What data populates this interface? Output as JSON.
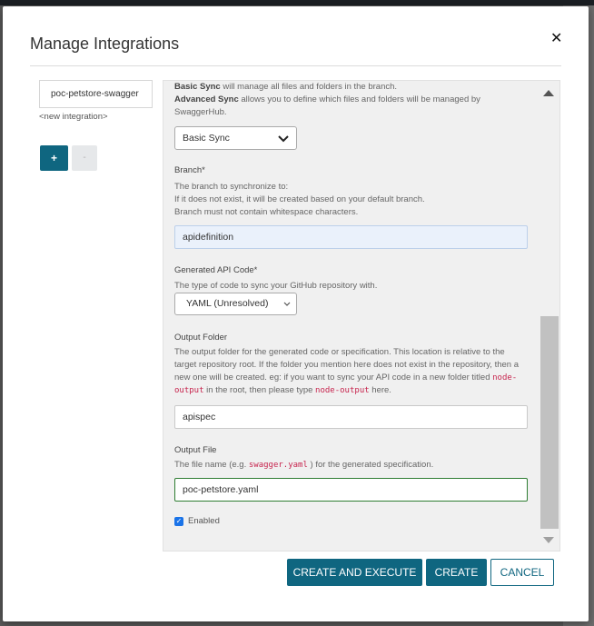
{
  "modal": {
    "title": "Manage Integrations",
    "close_icon": "close-icon"
  },
  "sidebar": {
    "integrations": [
      {
        "label": "poc-petstore-swagger"
      }
    ],
    "new_integration_label": "<new integration>",
    "add_label": "+",
    "remove_label": "-"
  },
  "form": {
    "sync_desc": {
      "basic_bold": "Basic Sync",
      "basic_rest": " will manage all files and folders in the branch.",
      "advanced_bold": "Advanced Sync",
      "advanced_rest": " allows you to define which files and folders will be managed by SwaggerHub."
    },
    "sync_mode": {
      "selected": "Basic Sync"
    },
    "branch": {
      "label": "Branch*",
      "desc_line1": "The branch to synchronize to:",
      "desc_line2": "If it does not exist, it will be created based on your default branch.",
      "desc_line3": "Branch must not contain whitespace characters.",
      "value": "apidefinition"
    },
    "generated_code": {
      "label": "Generated API Code*",
      "desc": "The type of code to sync your GitHub repository with.",
      "selected": "YAML (Unresolved)"
    },
    "output_folder": {
      "label": "Output Folder",
      "desc_part1": "The output folder for the generated code or specification. This location is relative to the target repository root. If the folder you mention here does not exist in the repository, then a new one will be created. eg: if you want to sync your API code in a new folder titled ",
      "code1": "node-output",
      "desc_part2": " in the root, then please type ",
      "code2": "node-output",
      "desc_part3": " here.",
      "value": "apispec"
    },
    "output_file": {
      "label": "Output File",
      "desc_part1": "The file name (e.g. ",
      "code": "swagger.yaml",
      "desc_part2": " ) for the generated specification.",
      "value": "poc-petstore.yaml"
    },
    "enabled": {
      "label": "Enabled",
      "checked": true
    }
  },
  "footer": {
    "create_execute_label": "CREATE AND EXECUTE",
    "create_label": "CREATE",
    "cancel_label": "CANCEL"
  },
  "colors": {
    "primary": "#0f6680",
    "code_text": "#c7254e",
    "checkbox": "#1a73e8",
    "focus_border": "#2e7d32"
  }
}
